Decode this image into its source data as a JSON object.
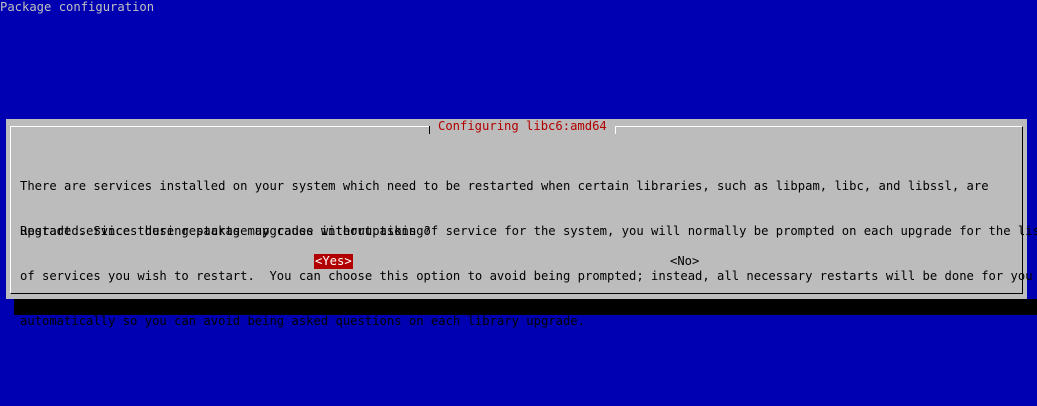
{
  "screen": {
    "backtitle": "Package configuration"
  },
  "dialog": {
    "title": "Configuring libc6:amd64",
    "message_lines": [
      "There are services installed on your system which need to be restarted when certain libraries, such as libpam, libc, and libssl, are",
      "upgraded. Since these restarts may cause interruptions of service for the system, you will normally be prompted on each upgrade for the list",
      "of services you wish to restart.  You can choose this option to avoid being prompted; instead, all necessary restarts will be done for you",
      "automatically so you can avoid being asked questions on each library upgrade."
    ],
    "question": "Restart services during package upgrades without asking?",
    "buttons": {
      "yes": "<Yes>",
      "no": "<No>"
    },
    "selected_button": "yes"
  },
  "colors": {
    "background": "#0000b2",
    "dialog": "#bcbcbc",
    "title": "#b20000",
    "selected_button_bg": "#b20000",
    "selected_button_fg": "#ffffff",
    "shadow": "#000000"
  }
}
